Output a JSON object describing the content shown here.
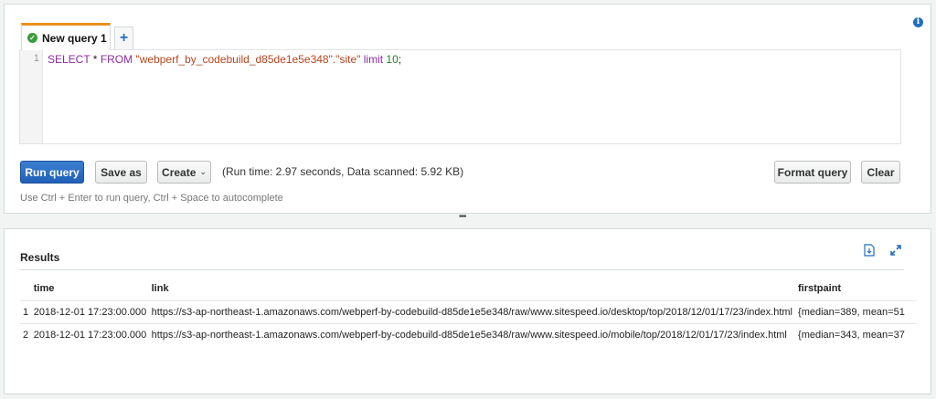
{
  "editor": {
    "tab_label": "New query 1",
    "add_tab": "+",
    "info": "i",
    "line_number": "1",
    "query": {
      "select": "SELECT",
      "star": " * ",
      "from": "FROM",
      "table": "\"webperf_by_codebuild_d85de1e5e348\".\"site\"",
      "limit": "limit",
      "n": "10",
      "end": ";"
    }
  },
  "toolbar": {
    "run_label": "Run query",
    "save_as_label": "Save as",
    "create_label": "Create",
    "runtime_text": "(Run time: 2.97 seconds, Data scanned: 5.92 KB)",
    "format_label": "Format query",
    "clear_label": "Clear",
    "hint": "Use Ctrl + Enter to run query, Ctrl + Space to autocomplete"
  },
  "splitter": "•••",
  "results": {
    "title": "Results",
    "columns": [
      "time",
      "link",
      "firstpaint"
    ],
    "rows": [
      {
        "n": "1",
        "time": "2018-12-01 17:23:00.000",
        "link": "https://s3-ap-northeast-1.amazonaws.com/webperf-by-codebuild-d85de1e5e348/raw/www.sitespeed.io/desktop/top/2018/12/01/17/23/index.html",
        "firstpaint": "{median=389, mean=51"
      },
      {
        "n": "2",
        "time": "2018-12-01 17:23:00.000",
        "link": "https://s3-ap-northeast-1.amazonaws.com/webperf-by-codebuild-d85de1e5e348/raw/www.sitespeed.io/mobile/top/2018/12/01/17/23/index.html",
        "firstpaint": "{median=343, mean=37"
      }
    ]
  },
  "colors": {
    "accent_tab": "#e8921c",
    "primary_button": "#2060b8",
    "link_icon": "#1f6fc4"
  }
}
